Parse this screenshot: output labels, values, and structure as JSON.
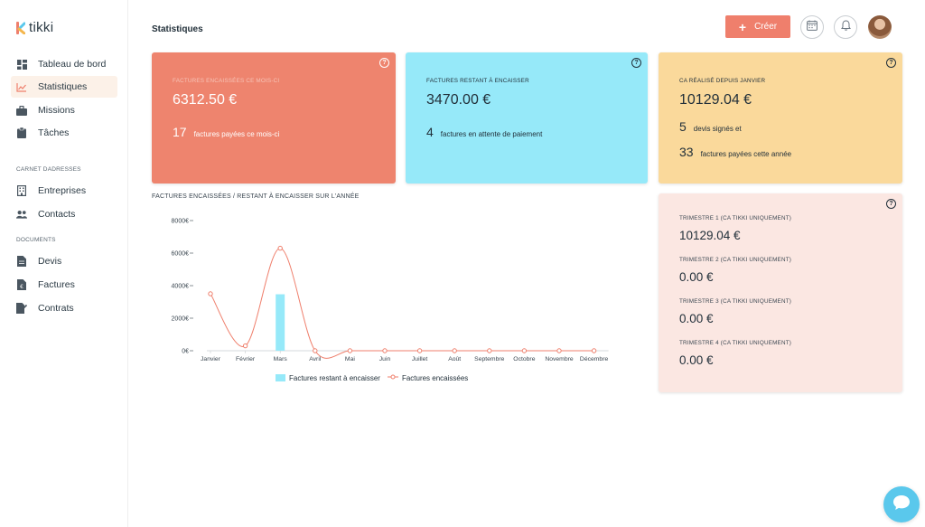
{
  "app": {
    "logo_text": "tikki"
  },
  "sidebar": {
    "items": [
      {
        "label": "Tableau de bord",
        "icon": "dashboard-icon"
      },
      {
        "label": "Statistiques",
        "icon": "chart-icon",
        "active": true
      },
      {
        "label": "Missions",
        "icon": "briefcase-icon"
      },
      {
        "label": "Tâches",
        "icon": "clipboard-icon"
      }
    ],
    "sections": [
      {
        "title": "CARNET DADRESSES",
        "items": [
          {
            "label": "Entreprises",
            "icon": "building-icon"
          },
          {
            "label": "Contacts",
            "icon": "users-icon"
          }
        ]
      },
      {
        "title": "DOCUMENTS",
        "items": [
          {
            "label": "Devis",
            "icon": "document-icon"
          },
          {
            "label": "Factures",
            "icon": "invoice-icon"
          },
          {
            "label": "Contrats",
            "icon": "contract-icon"
          }
        ]
      }
    ]
  },
  "header": {
    "title": "Statistiques",
    "create_label": "Créer"
  },
  "cards": {
    "red": {
      "label": "FACTURES ENCAISSÉES CE MOIS-CI",
      "amount": "6312.50 €",
      "count": "17",
      "count_text": "factures payées ce mois-ci"
    },
    "blue": {
      "label": "FACTURES RESTANT À ENCAISSER",
      "amount": "3470.00 €",
      "count": "4",
      "count_text": "factures en attente de paiement"
    },
    "yellow": {
      "label": "CA RÉALISÉ DEPUIS JANVIER",
      "amount": "10129.04 €",
      "count1": "5",
      "count1_text": "devis signés et",
      "count2": "33",
      "count2_text": "factures payées cette année"
    },
    "quarters": [
      {
        "label": "TRIMESTRE 1 (CA TIKKI UNIQUEMENT)",
        "amount": "10129.04 €"
      },
      {
        "label": "TRIMESTRE 2 (CA TIKKI UNIQUEMENT)",
        "amount": "0.00 €"
      },
      {
        "label": "TRIMESTRE 3 (CA TIKKI UNIQUEMENT)",
        "amount": "0.00 €"
      },
      {
        "label": "TRIMESTRE 4 (CA TIKKI UNIQUEMENT)",
        "amount": "0.00 €"
      }
    ]
  },
  "colors": {
    "accent": "#ef7f6c",
    "bar": "#96e9f9",
    "line": "#ef7f6c",
    "chat": "#5ac8ec"
  },
  "chart_data": {
    "type": "bar",
    "title": "FACTURES ENCAISSÉES / RESTANT À ENCAISSER SUR L'ANNÉE",
    "categories": [
      "Janvier",
      "Février",
      "Mars",
      "Avril",
      "Mai",
      "Juin",
      "Juillet",
      "Août",
      "Septembre",
      "Octobre",
      "Novembre",
      "Décembre"
    ],
    "ylim": [
      0,
      8000
    ],
    "yticks": [
      "0€",
      "2000€",
      "4000€",
      "6000€",
      "8000€"
    ],
    "ytick_values": [
      0,
      2000,
      4000,
      6000,
      8000
    ],
    "series": [
      {
        "name": "Factures restant à encaisser",
        "type": "bar",
        "values": [
          0,
          0,
          3470,
          0,
          0,
          0,
          0,
          0,
          0,
          0,
          0,
          0
        ]
      },
      {
        "name": "Factures encaissées",
        "type": "line",
        "values": [
          3500,
          300,
          6300,
          0,
          0,
          0,
          0,
          0,
          0,
          0,
          0,
          0
        ]
      }
    ]
  },
  "chat": {
    "icon": "chat-icon"
  }
}
